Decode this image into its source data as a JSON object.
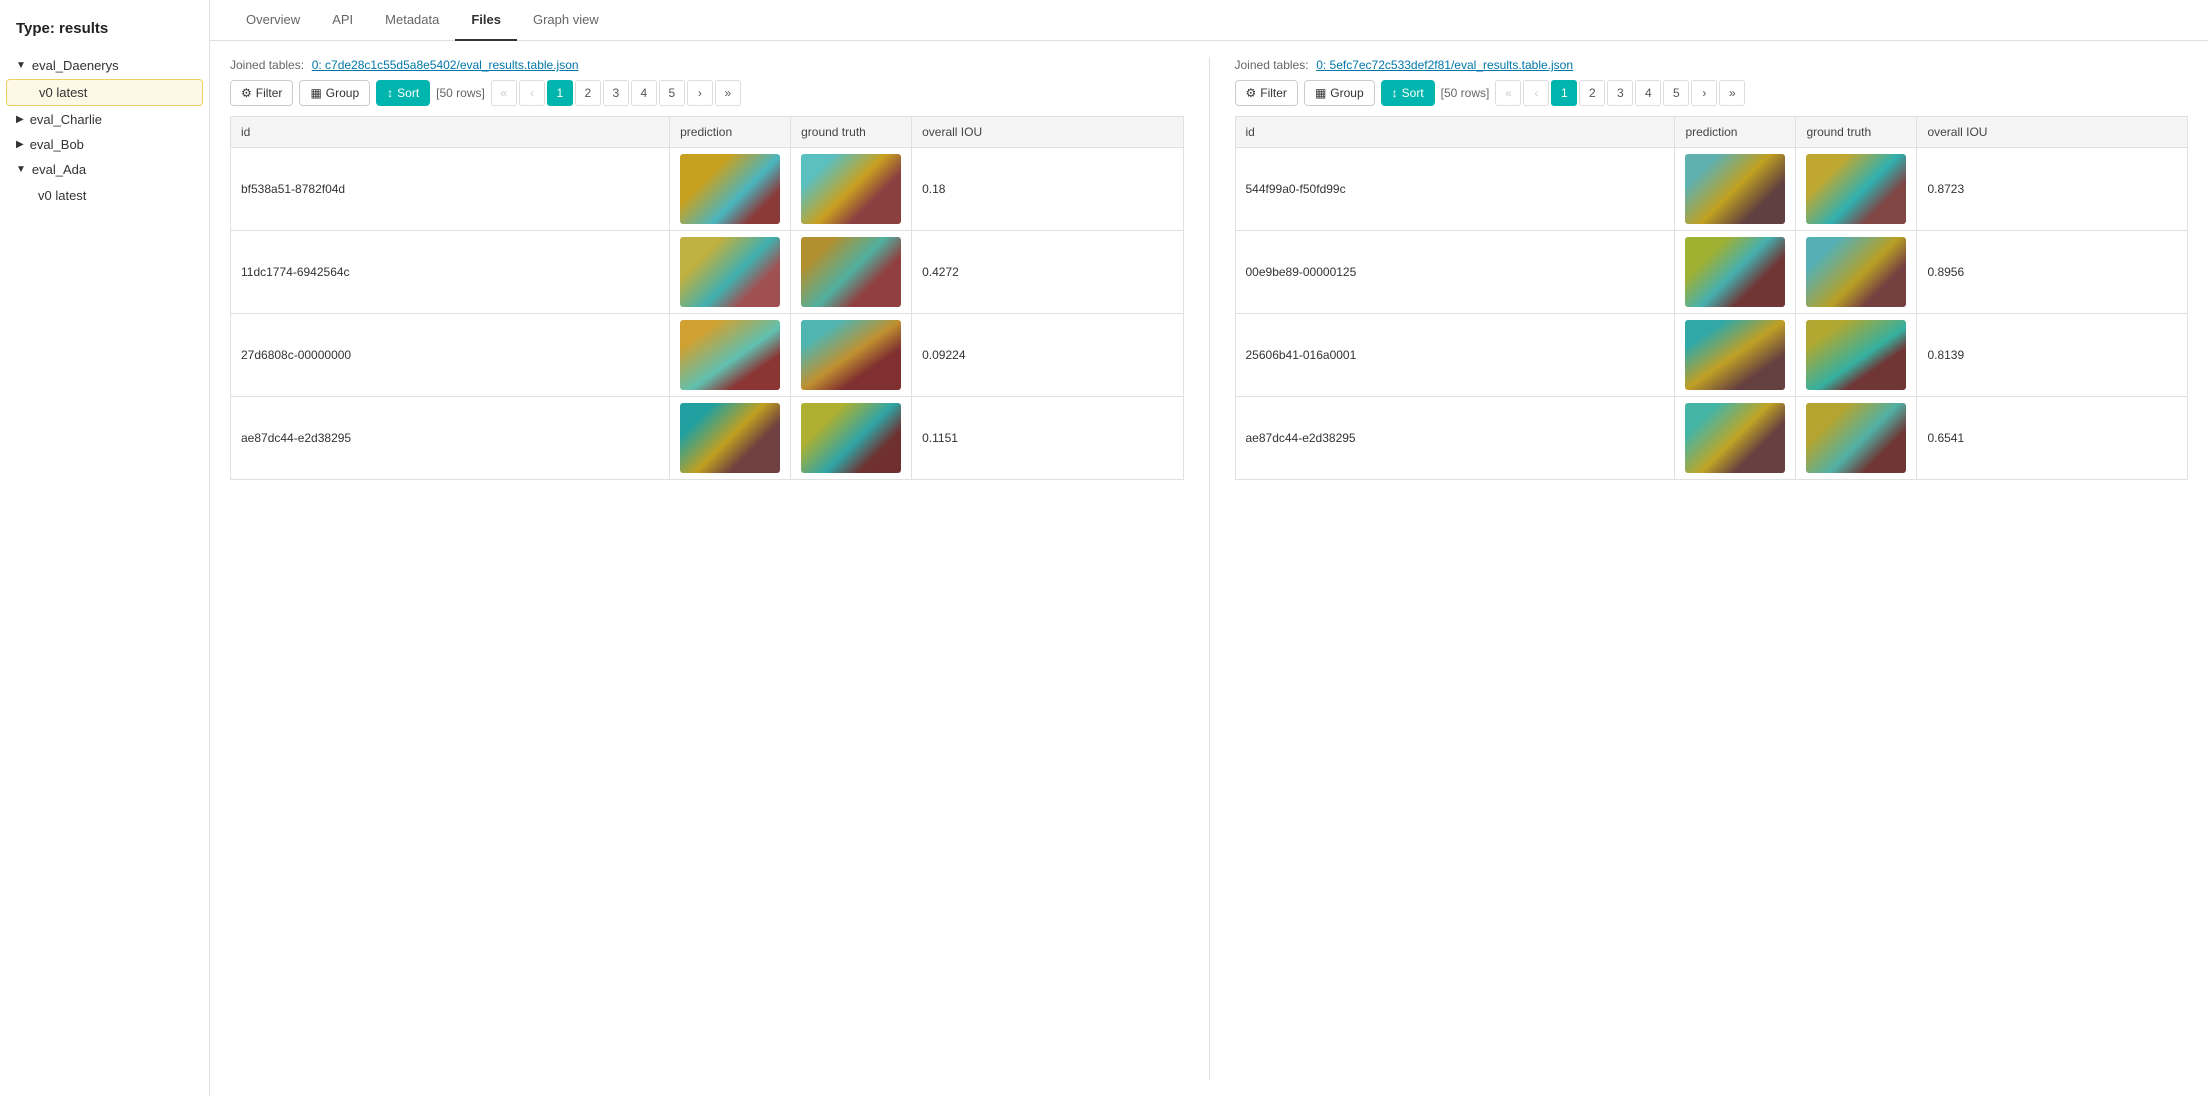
{
  "page": {
    "title": "Type: results"
  },
  "sidebar": {
    "groups": [
      {
        "label": "eval_Daenerys",
        "expanded": true,
        "items": [
          {
            "label": "v0 latest",
            "active": true
          }
        ]
      },
      {
        "label": "eval_Charlie",
        "expanded": false,
        "items": []
      },
      {
        "label": "eval_Bob",
        "expanded": false,
        "items": []
      },
      {
        "label": "eval_Ada",
        "expanded": true,
        "items": [
          {
            "label": "v0 latest",
            "active": false
          }
        ]
      }
    ]
  },
  "tabs": [
    {
      "label": "Overview",
      "active": false
    },
    {
      "label": "API",
      "active": false
    },
    {
      "label": "Metadata",
      "active": false
    },
    {
      "label": "Files",
      "active": true
    },
    {
      "label": "Graph view",
      "active": false
    }
  ],
  "left_panel": {
    "joined_label": "Joined tables:",
    "joined_link": "0: c7de28c1c55d5a8e5402/eval_results.table.json",
    "filter_label": "Filter",
    "group_label": "Group",
    "sort_label": "Sort",
    "rows_info": "[50 rows]",
    "pagination": {
      "pages": [
        "1",
        "2",
        "3",
        "4",
        "5"
      ]
    },
    "columns": [
      "id",
      "prediction",
      "ground truth",
      "overall IOU"
    ],
    "rows": [
      {
        "id": "bf538a51-8782f04d",
        "iou": "0.18",
        "pred_img": "img-seg-1",
        "truth_img": "img-seg-2"
      },
      {
        "id": "11dc1774-6942564c",
        "iou": "0.4272",
        "pred_img": "img-seg-3",
        "truth_img": "img-seg-4"
      },
      {
        "id": "27d6808c-00000000",
        "iou": "0.09224",
        "pred_img": "img-seg-5",
        "truth_img": "img-seg-6"
      },
      {
        "id": "ae87dc44-e2d38295",
        "iou": "0.1151",
        "pred_img": "img-seg-7",
        "truth_img": "img-seg-8"
      }
    ]
  },
  "right_panel": {
    "joined_label": "Joined tables:",
    "joined_link": "0: 5efc7ec72c533def2f81/eval_results.table.json",
    "filter_label": "Filter",
    "group_label": "Group",
    "sort_label": "Sort",
    "rows_info": "[50 rows]",
    "pagination": {
      "pages": [
        "1",
        "2",
        "3",
        "4",
        "5"
      ]
    },
    "columns": [
      "id",
      "prediction",
      "ground truth",
      "overall IOU"
    ],
    "rows": [
      {
        "id": "544f99a0-f50fd99c",
        "iou": "0.8723",
        "pred_img": "img-seg-r1",
        "truth_img": "img-seg-r2"
      },
      {
        "id": "00e9be89-00000125",
        "iou": "0.8956",
        "pred_img": "img-seg-r3",
        "truth_img": "img-seg-r4"
      },
      {
        "id": "25606b41-016a0001",
        "iou": "0.8139",
        "pred_img": "img-seg-r5",
        "truth_img": "img-seg-r6"
      },
      {
        "id": "ae87dc44-e2d38295",
        "iou": "0.6541",
        "pred_img": "img-seg-r7",
        "truth_img": "img-seg-r8"
      }
    ]
  }
}
